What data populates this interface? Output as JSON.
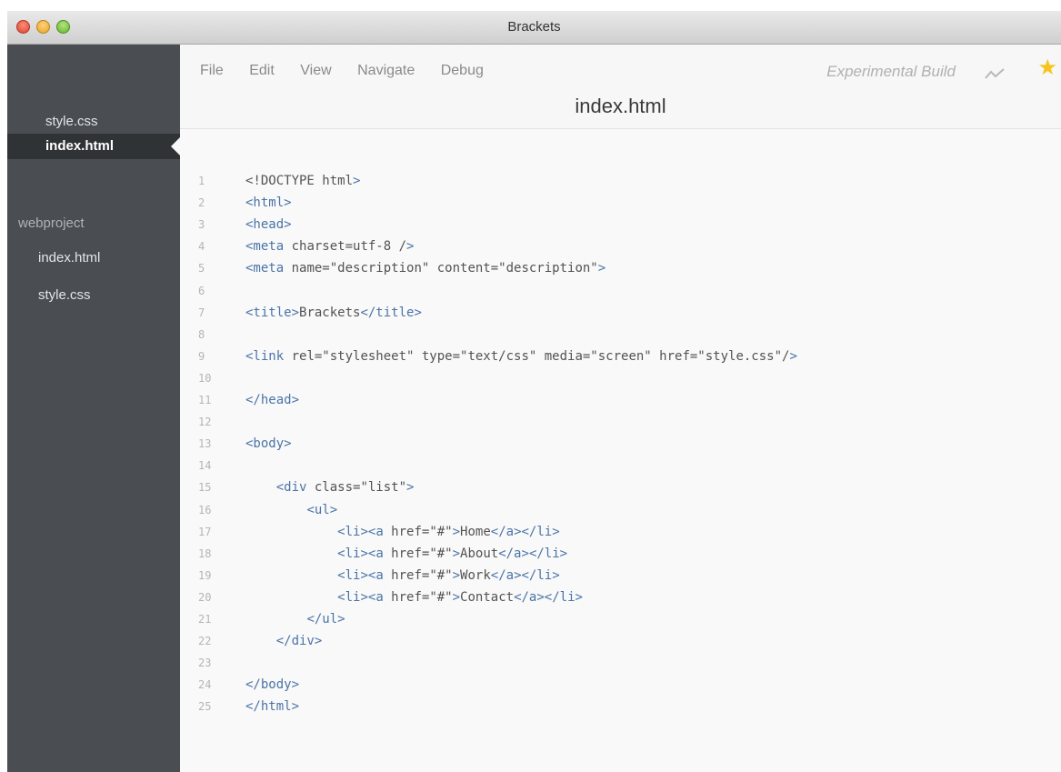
{
  "window": {
    "title": "Brackets"
  },
  "sidebar": {
    "working_files": [
      "style.css",
      "index.html"
    ],
    "project_name": "webproject",
    "project_files": [
      "index.html",
      "style.css"
    ]
  },
  "menu": {
    "items": [
      "File",
      "Edit",
      "View",
      "Navigate",
      "Debug"
    ],
    "build_label": "Experimental Build"
  },
  "editor": {
    "file_title": "index.html",
    "line_numbers": [
      "1",
      "2",
      "3",
      "4",
      "5",
      "6",
      "7",
      "8",
      "9",
      "10",
      "11",
      "12",
      "13",
      "14",
      "15",
      "16",
      "17",
      "18",
      "19",
      "20",
      "21",
      "22",
      "23",
      "24",
      "25"
    ],
    "lines": [
      "<!DOCTYPE html>",
      "<html>",
      "<head>",
      "<meta charset=utf-8 />",
      "<meta name=\"description\" content=\"description\">",
      "",
      "<title>Brackets</title>",
      "",
      "<link rel=\"stylesheet\" type=\"text/css\" media=\"screen\" href=\"style.css\"/>",
      "",
      "</head>",
      "",
      "<body>",
      "",
      "    <div class=\"list\">",
      "        <ul>",
      "            <li><a href=\"#\">Home</a></li>",
      "            <li><a href=\"#\">About</a></li>",
      "            <li><a href=\"#\">Work</a></li>",
      "            <li><a href=\"#\">Contact</a></li>",
      "        </ul>",
      "    </div>",
      "",
      "</body>",
      "</html>"
    ]
  },
  "colors": {
    "sidebar_bg": "#4a4e52",
    "selected_bg": "#303336",
    "tag": "#4a74a8",
    "attribute": "#6b8a2a",
    "string": "#e39c2d",
    "star": "#f7c41d"
  },
  "icons": [
    "close-button",
    "minimize-button",
    "zoom-button",
    "live-preview-icon",
    "star-icon"
  ]
}
